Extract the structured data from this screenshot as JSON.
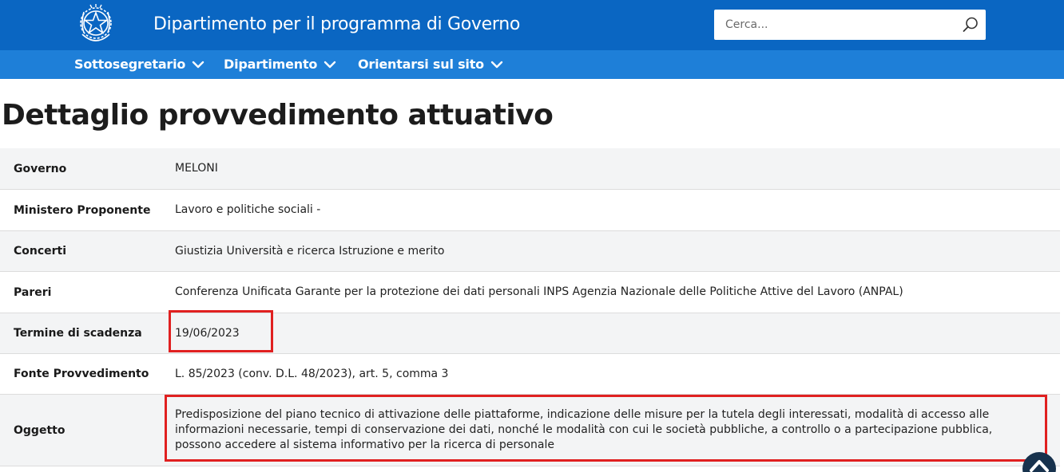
{
  "header": {
    "site_title": "Dipartimento per il programma di Governo",
    "search_placeholder": "Cerca...",
    "brand_color": "#0a66c2",
    "nav_color": "#1e7fd8"
  },
  "nav": {
    "items": [
      {
        "label": "Sottosegretario",
        "icon": "chevron-down-icon"
      },
      {
        "label": "Dipartimento",
        "icon": "chevron-down-icon"
      },
      {
        "label": "Orientarsi sul sito",
        "icon": "chevron-down-icon"
      }
    ]
  },
  "main": {
    "page_title": "Dettaglio provvedimento attuativo",
    "rows": [
      {
        "label": "Governo",
        "value": "MELONI"
      },
      {
        "label": "Ministero Proponente",
        "value": "Lavoro e politiche sociali -"
      },
      {
        "label": "Concerti",
        "value": "Giustizia Università e ricerca Istruzione e merito"
      },
      {
        "label": "Pareri",
        "value": "Conferenza Unificata Garante per la protezione dei dati personali INPS Agenzia Nazionale delle Politiche Attive del Lavoro (ANPAL)"
      },
      {
        "label": "Termine di scadenza",
        "value": "19/06/2023"
      },
      {
        "label": "Fonte Provvedimento",
        "value": "L. 85/2023 (conv. D.L. 48/2023), art. 5, comma 3"
      },
      {
        "label": "Oggetto",
        "value": "Predisposizione del piano tecnico di attivazione delle piattaforme, indicazione delle misure per la tutela degli interessati, modalità di accesso alle informazioni necessarie, tempi di conservazione dei dati, nonché le modalità con cui le società pubbliche, a controllo o a partecipazione pubblica, possono accedere al sistema informativo per la ricerca di personale"
      }
    ]
  },
  "highlight_color": "#e02020",
  "scroll_top_icon": "chevron-up-icon"
}
